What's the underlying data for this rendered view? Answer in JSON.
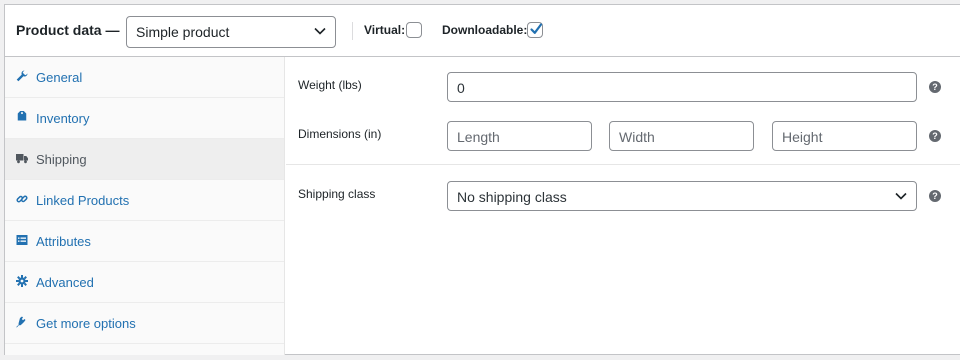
{
  "header": {
    "title": "Product data —",
    "product_type": "Simple product",
    "virtual_label": "Virtual:",
    "virtual_checked": false,
    "downloadable_label": "Downloadable:",
    "downloadable_checked": true
  },
  "tabs": [
    {
      "label": "General",
      "icon": "wrench-icon",
      "active": false
    },
    {
      "label": "Inventory",
      "icon": "tag-icon",
      "active": false
    },
    {
      "label": "Shipping",
      "icon": "truck-icon",
      "active": true
    },
    {
      "label": "Linked Products",
      "icon": "link-icon",
      "active": false
    },
    {
      "label": "Attributes",
      "icon": "list-icon",
      "active": false
    },
    {
      "label": "Advanced",
      "icon": "gear-icon",
      "active": false
    },
    {
      "label": "Get more options",
      "icon": "plugin-icon",
      "active": false
    }
  ],
  "shipping": {
    "weight_label": "Weight (lbs)",
    "weight_value": "0",
    "dimensions_label": "Dimensions (in)",
    "length_placeholder": "Length",
    "width_placeholder": "Width",
    "height_placeholder": "Height",
    "shipping_class_label": "Shipping class",
    "shipping_class_value": "No shipping class",
    "help_glyph": "?"
  },
  "colors": {
    "link": "#2271b1",
    "active_tab_bg": "#eeeeee",
    "border": "#c3c4c7"
  }
}
